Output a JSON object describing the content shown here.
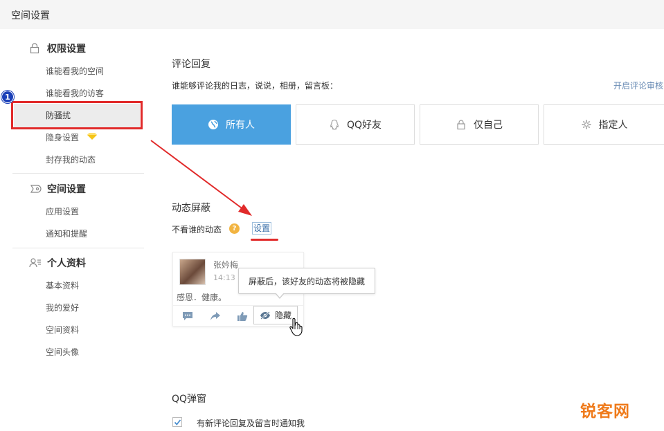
{
  "window": {
    "title": "空间设置"
  },
  "sidebar": {
    "sections": [
      {
        "label": "权限设置",
        "icon": "lock-icon"
      },
      {
        "label": "空间设置",
        "icon": "space-icon"
      },
      {
        "label": "个人资料",
        "icon": "profile-icon"
      }
    ],
    "items": {
      "who_can_view_space": "谁能看我的空间",
      "who_can_view_visitors": "谁能看我的访客",
      "anti_harass": "防骚扰",
      "invisible": "隐身设置",
      "archive_feeds": "封存我的动态",
      "app_settings": "应用设置",
      "notifications": "通知和提醒",
      "basic_info": "基本资料",
      "hobbies": "我的爱好",
      "space_info": "空间资料",
      "space_avatar": "空间头像"
    },
    "step_badge": "1"
  },
  "comment_reply": {
    "title": "评论回复",
    "question": "谁能够评论我的日志，说说，相册，留言板：",
    "review_link": "开启评论审核",
    "options": [
      {
        "label": "所有人",
        "icon": "globe-icon",
        "selected": true
      },
      {
        "label": "QQ好友",
        "icon": "qq-penguin-icon",
        "selected": false
      },
      {
        "label": "仅自己",
        "icon": "lock-icon",
        "selected": false
      },
      {
        "label": "指定人",
        "icon": "gear-icon",
        "selected": false
      }
    ]
  },
  "feed_block": {
    "title": "动态屏蔽",
    "label": "不看谁的动态",
    "help": "?",
    "settings_link": "设置",
    "example": {
      "username": "张妗梅",
      "time": "14:13",
      "content": "感恩．健康。",
      "hide_button": "隐藏",
      "tooltip": "屏蔽后，该好友的动态将被隐藏"
    }
  },
  "qq_popup": {
    "title": "QQ弹窗",
    "checkbox_label": "有新评论回复及留言时通知我",
    "checked": true
  },
  "watermark": "锐客网",
  "colors": {
    "accent": "#4aa1e0",
    "highlight_red": "#e12a2a",
    "badge_blue": "#1a3fb8",
    "link": "#6a8cb5",
    "watermark": "#ef7a1a"
  }
}
